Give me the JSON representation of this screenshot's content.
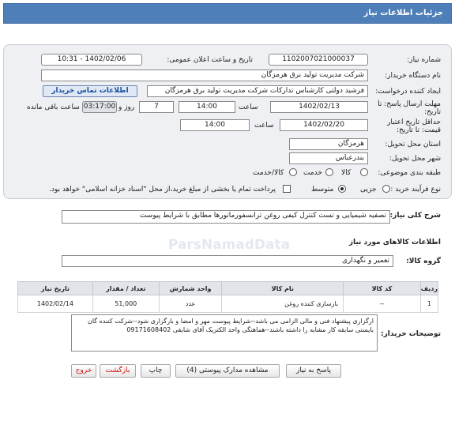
{
  "header": {
    "title": "جزئیات اطلاعات نیاز"
  },
  "form": {
    "need_number_label": "شماره نیاز:",
    "need_number": "1102007021000037",
    "announce_label": "تاریخ و ساعت اعلان عمومی:",
    "announce_value": "1402/02/06 - 10:31",
    "buyer_label": "نام دستگاه خریدار:",
    "buyer_value": "شرکت مدیریت تولید برق هرمزگان",
    "creator_label": "ایجاد کننده درخواست:",
    "creator_value": "فرشید دولتی کارشناس تدارکات شرکت مدیریت تولید برق هرمزگان",
    "contact_link": "اطلاعات تماس خریدار",
    "deadline_label_1": "مهلت ارسال پاسخ: تا",
    "deadline_label_2": "تاریخ:",
    "deadline_date": "1402/02/13",
    "time_label": "ساعت",
    "deadline_time": "14:00",
    "days_value": "7",
    "days_label": "روز و",
    "remaining_time": "03:17:00",
    "remaining_label": "ساعت باقی مانده",
    "validity_label_1": "حداقل تاریخ اعتبار",
    "validity_label_2": "قیمت: تا تاریخ:",
    "validity_date": "1402/02/20",
    "validity_time": "14:00",
    "province_label": "استان محل تحویل:",
    "province_value": "هرمزگان",
    "city_label": "شهر محل تحویل:",
    "city_value": "بندرعباس",
    "category_label": "طبقه بندی موضوعی:",
    "category_options": [
      "کالا",
      "خدمت",
      "کالا/خدمت"
    ],
    "process_label": "نوع فرآیند خرید :",
    "process_options": [
      "جزیی",
      "متوسط"
    ],
    "payment_note": "پرداخت تمام یا بخشی از مبلغ خرید،از محل \"اسناد خزانه اسلامی\" خواهد بود."
  },
  "summary": {
    "label": "شرح کلی نیاز:",
    "value": "تصفیه شیمیایی و تست کنترل کیفی روغن ترانسفورماتورها مطابق با شرایط پیوست"
  },
  "goods": {
    "section_title": "اطلاعات کالاهای مورد نیاز",
    "group_label": "گروه کالا:",
    "group_value": "تعمیر و نگهداری",
    "columns": [
      "ردیف",
      "کد کالا",
      "نام کالا",
      "واحد شمارش",
      "تعداد / مقدار",
      "تاریخ نیاز"
    ],
    "rows": [
      {
        "row": "1",
        "code": "--",
        "name": "بازسازی کننده روغن",
        "unit": "عدد",
        "qty": "51,000",
        "date": "1402/02/14"
      }
    ]
  },
  "buyer_notes": {
    "label": "توضیحات خریدار:",
    "text": "ارگزاری پیشنهاد فنی و مالی الزامی می باشد--شرایط پیوست مهر و امضا و بارگزاری شود--شرکت کننده گان بایستی سابقه کار مشابه را داشته باشند--هماهنگی واحد الکتریک آقای شایقی 09171608402"
  },
  "buttons": {
    "reply": "پاسخ به نیاز",
    "view_docs": "مشاهده مدارک پیوستی (4)",
    "print": "چاپ",
    "back": "بازگشت",
    "exit": "خروج"
  },
  "watermark": {
    "text": "ParsNamadData"
  }
}
